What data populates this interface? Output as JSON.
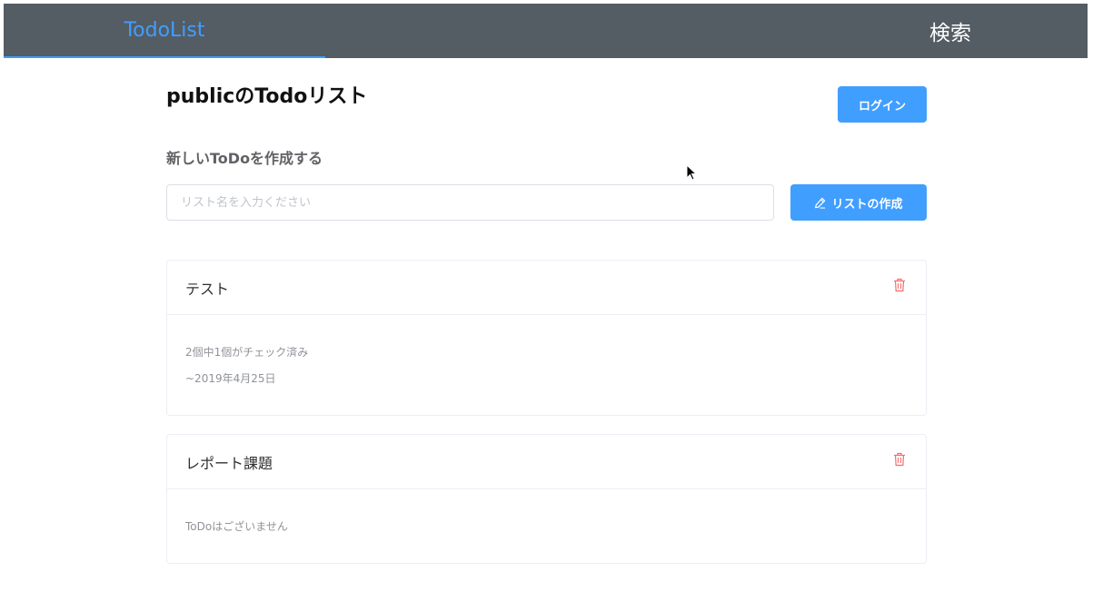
{
  "navbar": {
    "brand": "TodoList",
    "search": "検索"
  },
  "page": {
    "title": "publicのTodoリスト",
    "login_label": "ログイン"
  },
  "create": {
    "section_title": "新しいToDoを作成する",
    "placeholder": "リスト名を入力ください",
    "value": "",
    "button_label": "リストの作成",
    "button_icon": "pencil-icon"
  },
  "lists": [
    {
      "title": "テスト",
      "lines": [
        "2個中1個がチェック済み",
        "~2019年4月25日"
      ],
      "delete_icon": "trash-icon"
    },
    {
      "title": "レポート課題",
      "lines": [
        "ToDoはございません"
      ],
      "delete_icon": "trash-icon"
    }
  ],
  "colors": {
    "navbar_bg": "#545c64",
    "accent": "#409eff",
    "danger": "#f56c6c"
  }
}
